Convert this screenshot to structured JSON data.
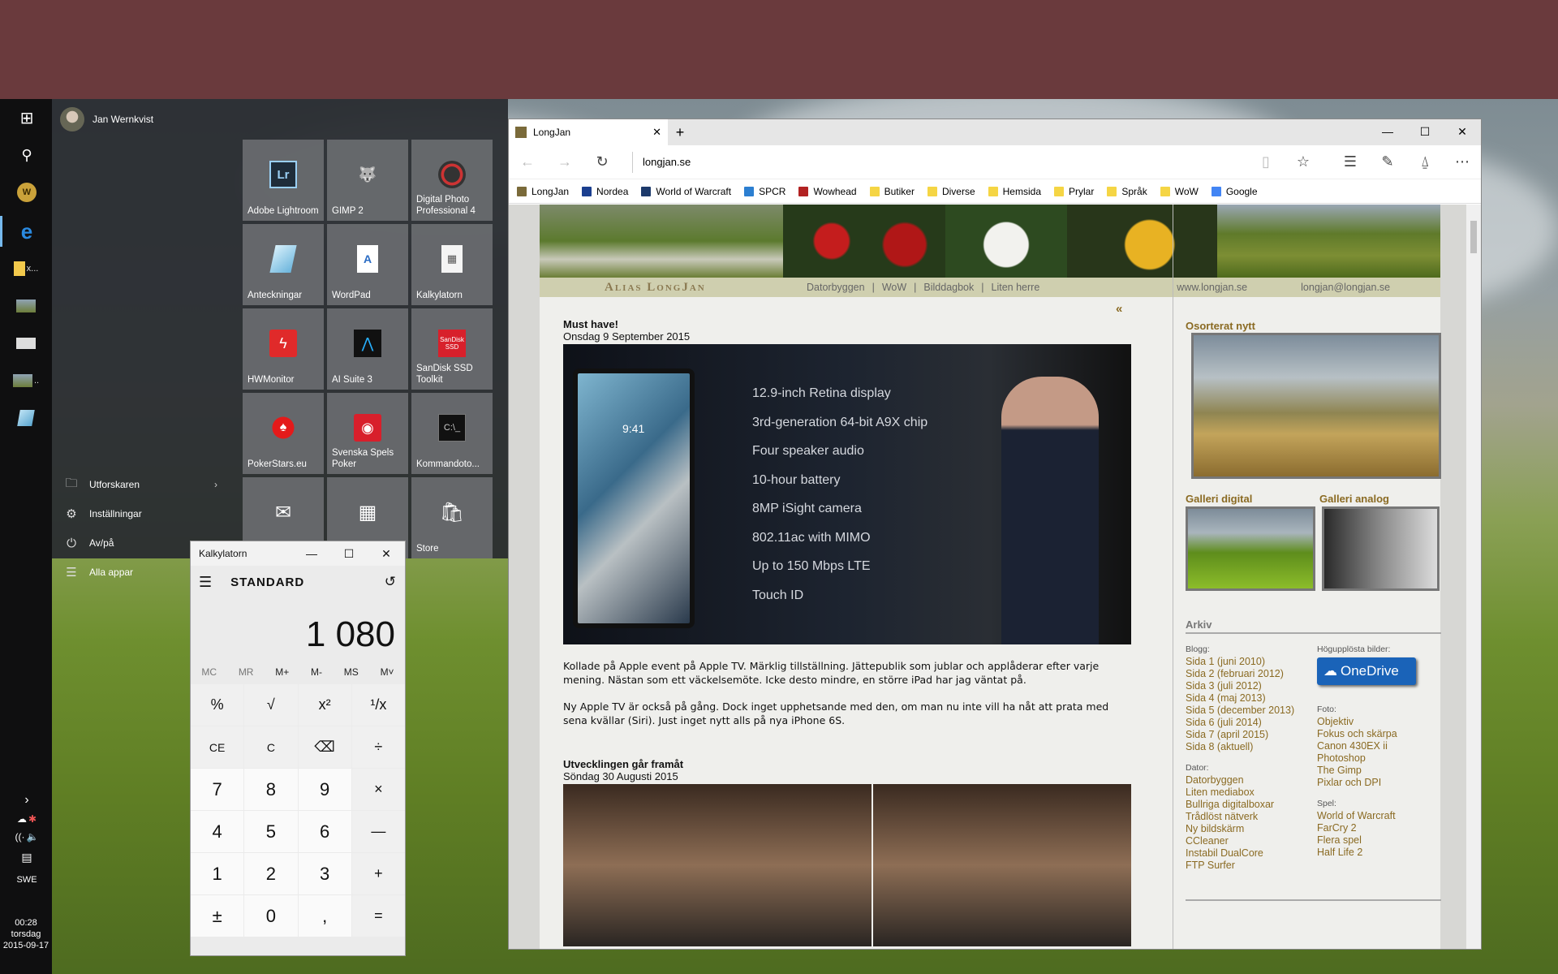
{
  "start": {
    "user": "Jan Wernkvist",
    "items": [
      {
        "icon": "folder-icon",
        "label": "Utforskaren"
      },
      {
        "icon": "gear-icon",
        "label": "Inställningar"
      },
      {
        "icon": "power-icon",
        "label": "Av/på"
      },
      {
        "icon": "list-icon",
        "label": "Alla appar"
      }
    ],
    "tiles": [
      {
        "label": "Adobe Lightroom",
        "icon": "lightroom-icon"
      },
      {
        "label": "GIMP 2",
        "icon": "gimp-icon"
      },
      {
        "label": "Digital Photo Professional 4",
        "icon": "dpp-icon"
      },
      {
        "label": "Anteckningar",
        "icon": "notepad-icon"
      },
      {
        "label": "WordPad",
        "icon": "wordpad-icon"
      },
      {
        "label": "Kalkylatorn",
        "icon": "calculator-icon"
      },
      {
        "label": "HWMonitor",
        "icon": "hwmonitor-icon"
      },
      {
        "label": "AI Suite 3",
        "icon": "aisuite-icon"
      },
      {
        "label": "SanDisk SSD Toolkit",
        "icon": "sandisk-icon"
      },
      {
        "label": "PokerStars.eu",
        "icon": "pokerstars-icon"
      },
      {
        "label": "Svenska Spels Poker",
        "icon": "svenskaspel-icon"
      },
      {
        "label": "Kommandoto...",
        "icon": "cmd-icon"
      },
      {
        "label": "",
        "icon": "mail-icon"
      },
      {
        "label": "",
        "icon": "calendar-icon"
      },
      {
        "label": "Store",
        "icon": "store-icon"
      }
    ],
    "lightroom_glyph": "Lr",
    "sandisk_glyph": "SanDisk SSD"
  },
  "taskbar": {
    "start_glyph": "⊞",
    "search_glyph": "⚲",
    "wow_glyph": "W",
    "edge_glyph": "e",
    "explorer_label": "x...",
    "photo_label": "..",
    "tray_arrow": "›",
    "notif_glyph": "▤",
    "lang": "SWE",
    "time": "00:28",
    "day": "torsdag",
    "date": "2015-09-17"
  },
  "calc": {
    "title": "Kalkylatorn",
    "mode": "STANDARD",
    "display": "1 080",
    "memory": [
      "MC",
      "MR",
      "M+",
      "M-",
      "MS",
      "M˅"
    ],
    "keys": [
      "%",
      "√",
      "x²",
      "¹/x",
      "CE",
      "C",
      "⌫",
      "÷",
      "7",
      "8",
      "9",
      "×",
      "4",
      "5",
      "6",
      "—",
      "1",
      "2",
      "3",
      "+",
      "±",
      "0",
      ",",
      "="
    ],
    "min": "—",
    "max": "☐",
    "close": "✕",
    "menu": "☰",
    "history": "↺"
  },
  "edge": {
    "tab_title": "LongJan",
    "tab_close": "✕",
    "new_tab": "+",
    "url": "longjan.se",
    "win_min": "—",
    "win_max": "☐",
    "win_close": "✕",
    "back": "←",
    "forward": "→",
    "refresh": "↻",
    "reading": "▯",
    "star": "☆",
    "hub": "☰",
    "note": "✎",
    "share": "⍙",
    "more": "⋯",
    "favorites": [
      {
        "label": "LongJan",
        "color": "#7a6a3a"
      },
      {
        "label": "Nordea",
        "color": "#1b3f8f"
      },
      {
        "label": "World of Warcraft",
        "color": "#1d3a6b"
      },
      {
        "label": "SPCR",
        "color": "#2c7fd1"
      },
      {
        "label": "Wowhead",
        "color": "#b22222"
      },
      {
        "label": "Butiker",
        "color": "#f5d544"
      },
      {
        "label": "Diverse",
        "color": "#f5d544"
      },
      {
        "label": "Hemsida",
        "color": "#f5d544"
      },
      {
        "label": "Prylar",
        "color": "#f5d544"
      },
      {
        "label": "Språk",
        "color": "#f5d544"
      },
      {
        "label": "WoW",
        "color": "#f5d544"
      },
      {
        "label": "Google",
        "color": "#4285f4"
      }
    ]
  },
  "site": {
    "logo": "Alias LongJan",
    "menu": [
      "Datorbyggen",
      "|",
      "WoW",
      "|",
      "Bilddagbok",
      "|",
      "Liten herre"
    ],
    "site_url": "www.longjan.se",
    "email": "longjan@longjan.se",
    "back_link": "«",
    "post1": {
      "title": "Must have!",
      "date": "Onsdag 9 September 2015",
      "specs": [
        "12.9-inch Retina display",
        "3rd-generation 64-bit A9X chip",
        "Four speaker audio",
        "10-hour battery",
        "8MP iSight camera",
        "802.11ac with MIMO",
        "Up to 150 Mbps LTE",
        "Touch ID"
      ],
      "ipad_time": "9:41",
      "p1": "Kollade på Apple event på Apple TV. Märklig tillställning. Jättepublik som jublar och applåderar efter varje mening. Nästan som ett väckelsemöte. Icke desto mindre, en större iPad har jag väntat på.",
      "p2": "Ny Apple TV är också på gång. Dock inget upphetsande med den, om man nu inte vill ha nåt att prata med sena kvällar (Siri). Just inget nytt alls på nya iPhone 6S."
    },
    "post2": {
      "title": "Utvecklingen går framåt",
      "date": "Söndag 30 Augusti 2015"
    },
    "side": {
      "osorterat": "Osorterat nytt",
      "galleri_digital": "Galleri digital",
      "galleri_analog": "Galleri analog",
      "arkiv": "Arkiv",
      "blogg_label": "Blogg:",
      "blogg": [
        "Sida 1 (juni 2010)",
        "Sida 2 (februari 2012)",
        "Sida 3 (juli 2012)",
        "Sida 4 (maj 2013)",
        "Sida 5 (december 2013)",
        "Sida 6 (juli 2014)",
        "Sida 7 (april 2015)",
        "Sida 8 (aktuell)"
      ],
      "dator_label": "Dator:",
      "dator": [
        "Datorbyggen",
        "Liten mediabox",
        "Bullriga digitalboxar",
        "Trådlöst nätverk",
        "Ny bildskärm",
        "CCleaner",
        "Instabil DualCore",
        "FTP Surfer"
      ],
      "hog_label": "Högupplösta bilder:",
      "onedrive": "OneDrive",
      "foto_label": "Foto:",
      "foto": [
        "Objektiv",
        "Fokus och skärpa",
        "Canon 430EX ii",
        "Photoshop",
        "The Gimp",
        "Pixlar och DPI"
      ],
      "spel_label": "Spel:",
      "spel": [
        "World of Warcraft",
        "FarCry 2",
        "Flera spel",
        "Half Life 2"
      ]
    }
  }
}
